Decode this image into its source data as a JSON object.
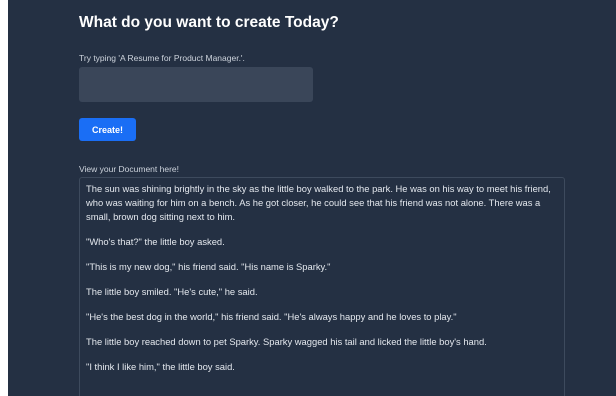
{
  "header": {
    "title": "What do you want to create Today?"
  },
  "prompt": {
    "hint": "Try typing 'A Resume for Product Manager.'.",
    "value": "",
    "placeholder": ""
  },
  "actions": {
    "create_label": "Create!"
  },
  "document": {
    "label": "View your Document here!",
    "paragraphs": [
      "The sun was shining brightly in the sky as the little boy walked to the park. He was on his way to meet his friend, who was waiting for him on a bench. As he got closer, he could see that his friend was not alone. There was a small, brown dog sitting next to him.",
      "\"Who's that?\" the little boy asked.",
      "\"This is my new dog,\" his friend said. \"His name is Sparky.\"",
      "The little boy smiled. \"He's cute,\" he said.",
      "\"He's the best dog in the world,\" his friend said. \"He's always happy and he loves to play.\"",
      "The little boy reached down to pet Sparky. Sparky wagged his tail and licked the little boy's hand.",
      "\"I think I like him,\" the little boy said."
    ]
  },
  "colors": {
    "background": "#243043",
    "input_background": "#3a4659",
    "button": "#1a6ef5",
    "text": "#ffffff"
  }
}
